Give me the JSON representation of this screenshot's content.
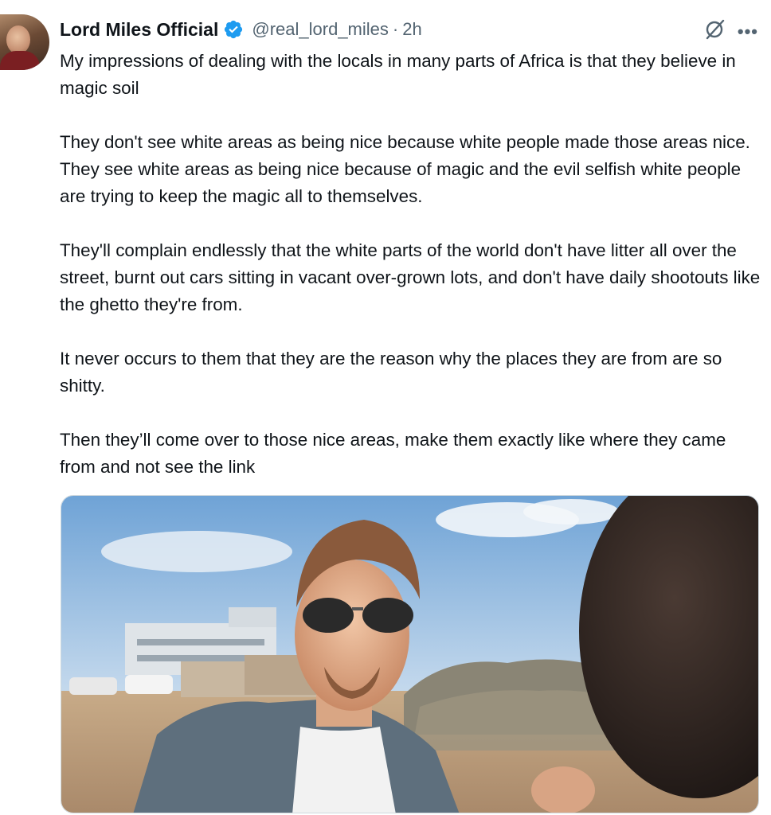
{
  "author": {
    "display_name": "Lord Miles Official",
    "handle": "@real_lord_miles",
    "separator": "·",
    "timestamp": "2h",
    "verified": true,
    "verified_color": "#1d9bf0"
  },
  "icons": {
    "verified": "verified-badge-icon",
    "grok": "grok-icon",
    "more": "more-options-icon",
    "more_glyph": "•••"
  },
  "tweet": {
    "paragraphs": [
      "My impressions of dealing with the locals in many parts of Africa is that they believe in magic soil",
      "They don't see white areas as being nice because white people made those areas nice. They see white areas as being nice because of magic and the evil selfish white people are trying to keep the magic all to themselves.",
      "They'll complain endlessly that the white parts of the world don't have litter all over the street, burnt out cars sitting in vacant over-grown lots, and don't have daily shootouts like the ghetto they're from.",
      "It never occurs to them that they are the reason why the places they are from are so shitty.",
      "Then they’ll come over to those nice areas, make them exactly like where they came from and not see the link"
    ]
  },
  "colors": {
    "text_primary": "#0f1419",
    "text_secondary": "#536471",
    "border": "#cfd9de"
  }
}
